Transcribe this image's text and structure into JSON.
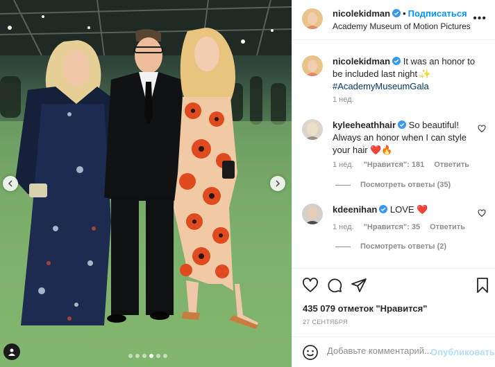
{
  "post": {
    "username": "nicolekidman",
    "follow_label": "Подписаться",
    "location": "Academy Museum of Motion Pictures",
    "more_label": "•••",
    "caption_text": "It was an honor to be included last night",
    "caption_emoji": "✨",
    "caption_hashtag": "#AcademyMuseumGala",
    "caption_time": "1 нед.",
    "likes_text": "435 079 отметок \"Нравится\"",
    "date_text": "27 СЕНТЯБРЯ"
  },
  "comments": [
    {
      "username": "kyleeheathhair",
      "text": "So beautiful! Always an honor when I can style your hair",
      "emojis": "❤️🔥",
      "time": "1 нед.",
      "likes": "\"Нравится\": 181",
      "reply_label": "Ответить",
      "view_replies": "Посмотреть ответы (35)"
    },
    {
      "username": "kdeenihan",
      "text": "LOVE",
      "emojis": "❤️",
      "time": "1 нед.",
      "likes": "\"Нравится\": 35",
      "reply_label": "Ответить",
      "view_replies": "Посмотреть ответы (2)"
    }
  ],
  "add_comment": {
    "placeholder": "Добавьте комментарий...",
    "post_label": "Опубликовать"
  },
  "carousel": {
    "dot_count": 6,
    "active_index": 3
  },
  "colors": {
    "link": "#0095f6",
    "hashtag": "#00376b",
    "muted": "#8e8e8e",
    "post_disabled": "#b2dffc"
  }
}
